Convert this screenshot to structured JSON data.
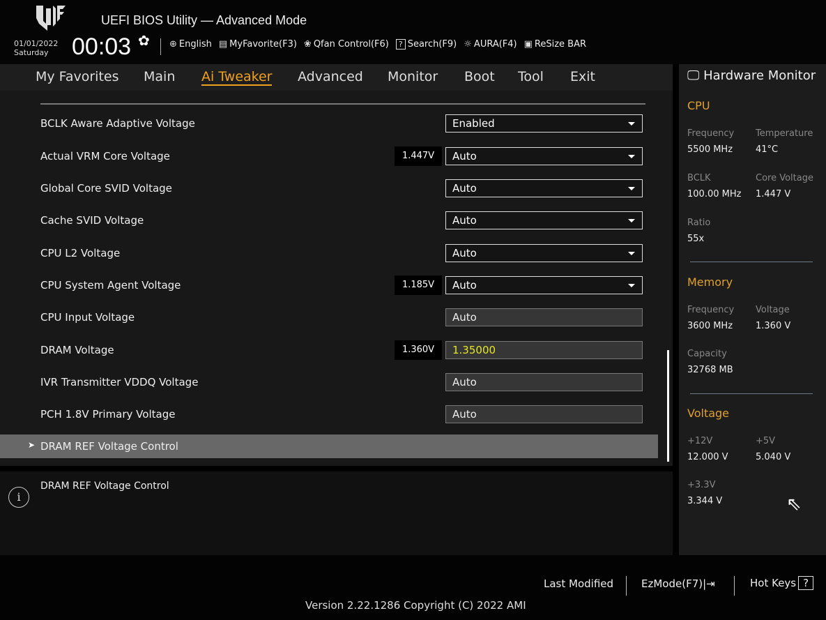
{
  "header": {
    "title": "UEFI BIOS Utility — Advanced Mode",
    "date": "01/01/2022",
    "day": "Saturday",
    "time": "00:03",
    "tools": [
      {
        "icon": "globe-icon",
        "label": "English"
      },
      {
        "icon": "favorite-list-icon",
        "label": "MyFavorite(F3)"
      },
      {
        "icon": "fan-icon",
        "label": "Qfan Control(F6)"
      },
      {
        "icon": "search-help-icon",
        "label": "Search(F9)"
      },
      {
        "icon": "aura-light-icon",
        "label": "AURA(F4)"
      },
      {
        "icon": "resize-bar-icon",
        "label": "ReSize BAR"
      }
    ]
  },
  "nav": {
    "tabs": [
      "My Favorites",
      "Main",
      "Ai Tweaker",
      "Advanced",
      "Monitor",
      "Boot",
      "Tool",
      "Exit"
    ],
    "active": "Ai Tweaker"
  },
  "settings": [
    {
      "label": "BCLK Aware Adaptive Voltage",
      "value": "Enabled",
      "type": "dropdown"
    },
    {
      "label": "Actual VRM Core Voltage",
      "reading": "1.447V",
      "value": "Auto",
      "type": "dropdown"
    },
    {
      "label": "Global Core SVID Voltage",
      "value": "Auto",
      "type": "dropdown"
    },
    {
      "label": "Cache SVID Voltage",
      "value": "Auto",
      "type": "dropdown"
    },
    {
      "label": "CPU L2 Voltage",
      "value": "Auto",
      "type": "dropdown"
    },
    {
      "label": "CPU System Agent Voltage",
      "reading": "1.185V",
      "value": "Auto",
      "type": "dropdown"
    },
    {
      "label": "CPU Input Voltage",
      "value": "Auto",
      "type": "input"
    },
    {
      "label": "DRAM Voltage",
      "reading": "1.360V",
      "value": "1.35000",
      "type": "input"
    },
    {
      "label": "IVR Transmitter VDDQ Voltage",
      "value": "Auto",
      "type": "input"
    },
    {
      "label": "PCH 1.8V Primary Voltage",
      "value": "Auto",
      "type": "input"
    }
  ],
  "submenu": {
    "label": "DRAM REF Voltage Control"
  },
  "help": {
    "text": "DRAM REF Voltage Control"
  },
  "hardware_monitor": {
    "title": "Hardware Monitor",
    "cpu": {
      "title": "CPU",
      "frequency_label": "Frequency",
      "frequency": "5500 MHz",
      "temperature_label": "Temperature",
      "temperature": "41°C",
      "bclk_label": "BCLK",
      "bclk": "100.00 MHz",
      "core_voltage_label": "Core Voltage",
      "core_voltage": "1.447 V",
      "ratio_label": "Ratio",
      "ratio": "55x"
    },
    "memory": {
      "title": "Memory",
      "frequency_label": "Frequency",
      "frequency": "3600 MHz",
      "voltage_label": "Voltage",
      "voltage": "1.360 V",
      "capacity_label": "Capacity",
      "capacity": "32768 MB"
    },
    "voltage": {
      "title": "Voltage",
      "v12_label": "+12V",
      "v12": "12.000 V",
      "v5_label": "+5V",
      "v5": "5.040 V",
      "v33_label": "+3.3V",
      "v33": "3.344 V"
    }
  },
  "footer": {
    "last_modified": "Last Modified",
    "ezmode": "EzMode(F7)",
    "hotkeys": "Hot Keys",
    "hotkeys_icon": "?",
    "version": "Version 2.22.1286 Copyright (C) 2022 AMI"
  },
  "colors": {
    "accent": "#f0a020",
    "highlight_value": "#e6e620"
  }
}
